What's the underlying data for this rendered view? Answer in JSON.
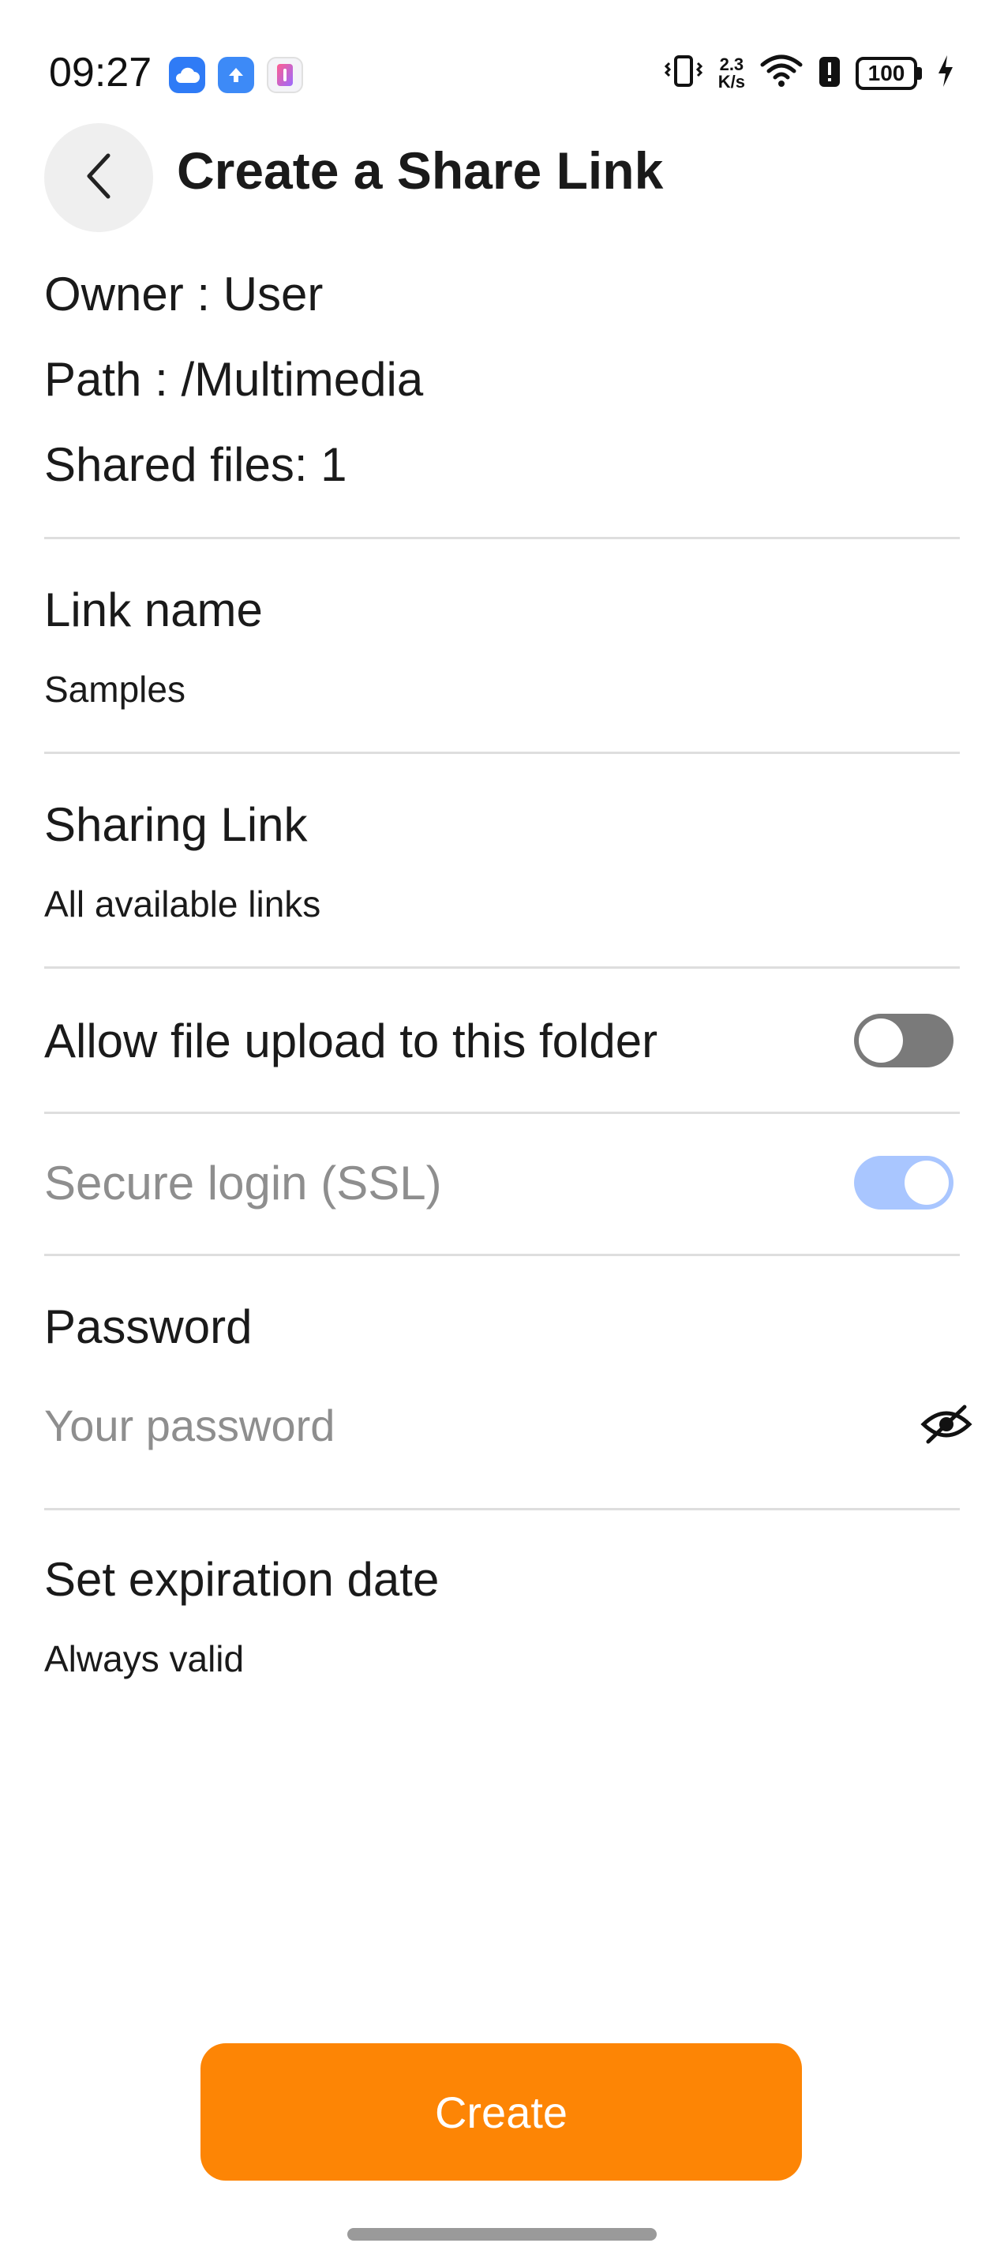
{
  "status_bar": {
    "time": "09:27",
    "net_speed_value": "2.3",
    "net_speed_unit": "K/s",
    "battery": "100",
    "icons": [
      "cloud-app-icon",
      "upload-app-icon",
      "notes-app-icon",
      "vibrate-icon",
      "wifi-icon",
      "alert-icon",
      "battery-icon",
      "charging-icon"
    ]
  },
  "header": {
    "title": "Create a Share Link",
    "back_icon": "chevron-left-icon"
  },
  "info": {
    "owner": "Owner : User",
    "path": "Path : /Multimedia",
    "shared_files": "Shared files: 1"
  },
  "link_name": {
    "label": "Link name",
    "value": "Samples"
  },
  "sharing_link": {
    "label": "Sharing Link",
    "value": "All available links"
  },
  "allow_upload": {
    "label": "Allow file upload to this folder",
    "enabled": false
  },
  "secure_login": {
    "label": "Secure login (SSL)",
    "enabled": true,
    "disabled": true
  },
  "password": {
    "label": "Password",
    "placeholder": "Your password",
    "visibility_icon": "eye-off-icon"
  },
  "expiration": {
    "label": "Set expiration date",
    "value": "Always valid"
  },
  "actions": {
    "create_label": "Create"
  },
  "colors": {
    "accent": "#fd8505",
    "toggle_on_disabled": "#a9c6ff",
    "toggle_off": "#7a7a7a"
  }
}
